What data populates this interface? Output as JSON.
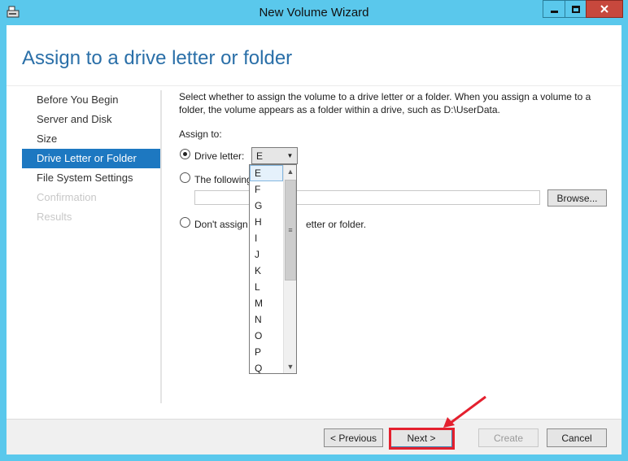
{
  "window": {
    "title": "New Volume Wizard"
  },
  "page": {
    "title": "Assign to a drive letter or folder"
  },
  "nav": {
    "items": [
      {
        "label": "Before You Begin",
        "state": "normal"
      },
      {
        "label": "Server and Disk",
        "state": "normal"
      },
      {
        "label": "Size",
        "state": "normal"
      },
      {
        "label": "Drive Letter or Folder",
        "state": "active"
      },
      {
        "label": "File System Settings",
        "state": "normal"
      },
      {
        "label": "Confirmation",
        "state": "disabled"
      },
      {
        "label": "Results",
        "state": "disabled"
      }
    ]
  },
  "content": {
    "description": "Select whether to assign the volume to a drive letter or a folder. When you assign a volume to a folder, the volume appears as a folder within a drive, such as D:\\UserData.",
    "assign_to_label": "Assign to:",
    "option_drive_letter": "Drive letter:",
    "option_folder": "The following",
    "option_none_part1": "Don't assign",
    "option_none_part2": "etter or folder.",
    "selected_option": "drive_letter",
    "drive_letter_value": "E",
    "folder_value": "",
    "browse_label": "Browse..."
  },
  "dropdown": {
    "items": [
      "E",
      "F",
      "G",
      "H",
      "I",
      "J",
      "K",
      "L",
      "M",
      "N",
      "O",
      "P",
      "Q"
    ],
    "selected": "E"
  },
  "footer": {
    "previous_label": "< Previous",
    "next_label": "Next >",
    "create_label": "Create",
    "cancel_label": "Cancel"
  },
  "colors": {
    "titlebar": "#5ac8ec",
    "accent": "#1d78c1",
    "title_text": "#2a6fa8",
    "highlight": "#e4202e"
  }
}
